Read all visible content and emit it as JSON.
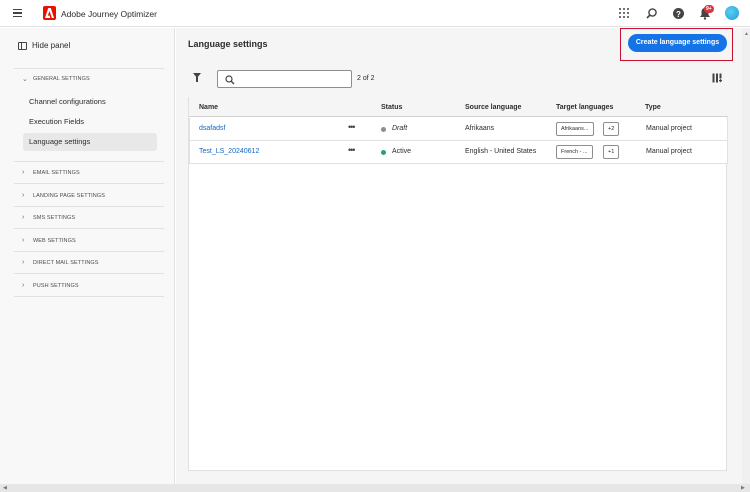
{
  "app": {
    "title": "Adobe Journey Optimizer",
    "notification_count": "9+"
  },
  "sidebar": {
    "hide_panel_label": "Hide panel",
    "general_section": "GENERAL SETTINGS",
    "general_items": [
      "Channel configurations",
      "Execution Fields",
      "Language settings"
    ],
    "active_item": "Language settings",
    "sections": [
      "EMAIL SETTINGS",
      "LANDING PAGE SETTINGS",
      "SMS SETTINGS",
      "WEB SETTINGS",
      "DIRECT MAIL SETTINGS",
      "PUSH SETTINGS"
    ]
  },
  "main": {
    "title": "Language settings",
    "create_button": "Create language settings",
    "search": {
      "value": "",
      "placeholder": ""
    },
    "count": "2 of 2",
    "columns": [
      "Name",
      "Status",
      "Source language",
      "Target languages",
      "Type"
    ],
    "rows": [
      {
        "name": "dsafadsf",
        "status": "Draft",
        "status_color": "#8e8e8e",
        "source": "Afrikaans",
        "target": "Afrikaans...",
        "more": "+2",
        "type": "Manual project"
      },
      {
        "name": "Test_LS_20240612",
        "status": "Active",
        "status_color": "#2d9d78",
        "source": "English - United States",
        "target": "French - ...",
        "more": "+1",
        "type": "Manual project"
      }
    ]
  },
  "colors": {
    "accent": "#1473e6",
    "brand": "#eb1000",
    "highlight": "#c8102e"
  }
}
